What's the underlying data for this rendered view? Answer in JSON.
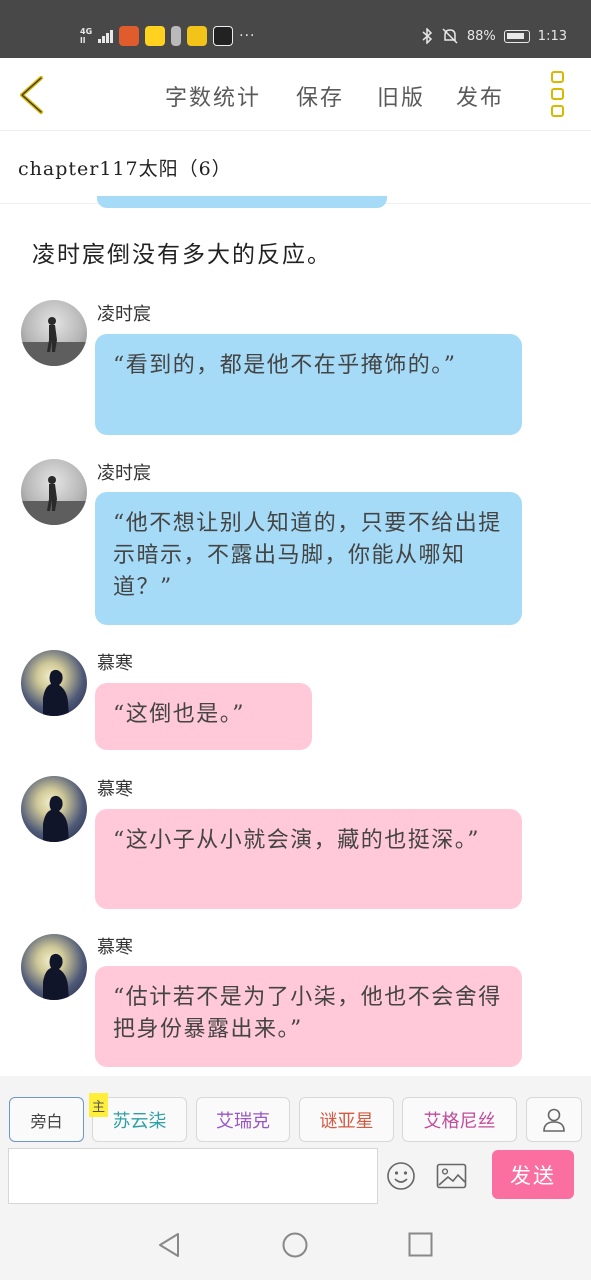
{
  "status_bar": {
    "network": "4G",
    "network_sub": "ll",
    "app_icon_colors": [
      "#e05c2d",
      "#ffd21f",
      "#3a3a3a",
      "#f2c318",
      "#222222"
    ],
    "more": "···",
    "battery": "88%",
    "time": "1:13"
  },
  "toolbar": {
    "word_count": "字数统计",
    "save": "保存",
    "old_version": "旧版",
    "publish": "发布"
  },
  "chapter_title": "chapter117太阳（6）",
  "narration": "凌时宸倒没有多大的反应。",
  "messages": [
    {
      "sender": "凌时宸",
      "text": "“看到的，都是他不在乎掩饰的。”",
      "color": "blue"
    },
    {
      "sender": "凌时宸",
      "text": "“他不想让别人知道的，只要不给出提示暗示，不露出马脚，你能从哪知道？”",
      "color": "blue"
    },
    {
      "sender": "慕寒",
      "text": "“这倒也是。”",
      "color": "pink"
    },
    {
      "sender": "慕寒",
      "text": "“这小子从小就会演，藏的也挺深。”",
      "color": "pink"
    },
    {
      "sender": "慕寒",
      "text": "“估计若不是为了小柒，他也不会舍得把身份暴露出来。”",
      "color": "pink"
    }
  ],
  "roles": {
    "narration": "旁白",
    "main_tag": "主",
    "r1": "苏云柒",
    "r2": "艾瑞克",
    "r3": "谜亚星",
    "r4": "艾格尼丝"
  },
  "input": {
    "value": ""
  },
  "send": "发送",
  "colors": {
    "blue_bubble": "#a6dbf7",
    "pink_bubble": "#ffc9d9",
    "send": "#fb6fa0",
    "accent": "#d9b800"
  }
}
